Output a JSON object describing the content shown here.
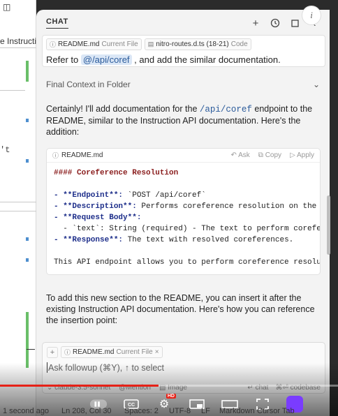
{
  "editor": {
    "tab_label": "e Instructi",
    "code_snippet": "'t"
  },
  "chat": {
    "title": "CHAT",
    "query": {
      "chips": [
        {
          "name": "README.md",
          "detail": "Current File",
          "icon": "info-icon"
        },
        {
          "name": "nitro-routes.d.ts (18-21)",
          "detail": "Code",
          "icon": "ts-file-icon"
        }
      ],
      "text_before": "Refer to",
      "mention": "@/api/coref",
      "text_after": ", and add the similar documentation."
    },
    "context_label": "Final Context in Folder",
    "answer": {
      "text_1": "Certainly! I'll add documentation for the",
      "code_ref": "/api/coref",
      "text_2": "endpoint to the README, similar to the Instruction API documentation. Here's the addition:"
    },
    "code_block": {
      "filename": "README.md",
      "actions": [
        "Ask",
        "Copy",
        "Apply"
      ],
      "lines": {
        "heading": "#### Coreference Resolution",
        "endpoint_key": "- **Endpoint**:",
        "endpoint_val": " `POST /api/coref`",
        "desc_key": "- **Description**:",
        "desc_val": " Performs coreference resolution on the",
        "req_key": "- **Request Body**:",
        "text_param": "  - `text`: String (required) - The text to perform corefe",
        "resp_key": "- **Response**:",
        "resp_val": " The text with resolved coreferences.",
        "footer": "This API endpoint allows you to perform coreference resolu"
      }
    },
    "followup_text": "To add this new section to the README, you can insert it after the existing Instruction API documentation. Here's how you can reference the insertion point:",
    "input": {
      "chip_name": "README.md",
      "chip_detail": "Current File",
      "placeholder": "Ask followup (⌘Y), ↑ to select",
      "model": "claude-3.5-sonnet",
      "mention": "@Mention",
      "image": "Image",
      "chat": "chat",
      "codebase": "⌘⏎ codebase"
    }
  },
  "video": {
    "progress": 0.47,
    "hd_label": "HD",
    "accent": "#e62117"
  },
  "status": {
    "time": "1 second ago",
    "position": "Ln 208, Col 30",
    "spaces": "Spaces: 2",
    "encoding": "UTF-8",
    "eol": "LF",
    "language": "Markdown",
    "cursor_tab": "Cursor Tab"
  }
}
